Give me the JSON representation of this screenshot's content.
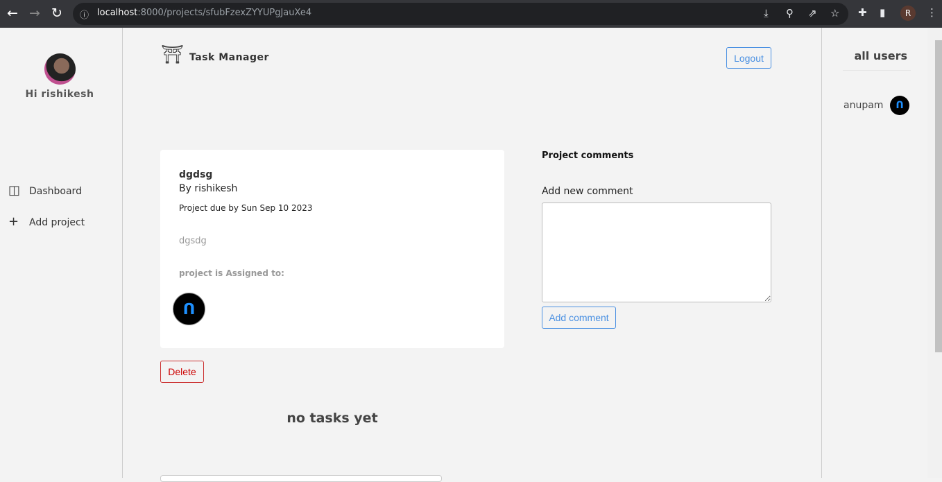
{
  "browser": {
    "url_host": "localhost",
    "url_path": ":8000/projects/sfubFzexZYYUPgJauXe4",
    "profile_initial": "R"
  },
  "sidebar": {
    "greeting": "Hi rishikesh",
    "items": [
      {
        "label": "Dashboard",
        "icon": "layout-icon"
      },
      {
        "label": "Add project",
        "icon": "plus-icon"
      }
    ]
  },
  "header": {
    "title": "Task Manager",
    "logout": "Logout"
  },
  "project": {
    "name": "dgdsg",
    "author": "By rishikesh",
    "due": "Project due by Sun Sep 10 2023",
    "description": "dgsdg",
    "assigned_label": "project is Assigned to:"
  },
  "delete_label": "Delete",
  "tasks_empty": "no tasks yet",
  "comments": {
    "title": "Project comments",
    "add_label": "Add new comment",
    "button": "Add comment"
  },
  "users": {
    "title": "all users",
    "list": [
      {
        "name": "anupam"
      }
    ]
  }
}
